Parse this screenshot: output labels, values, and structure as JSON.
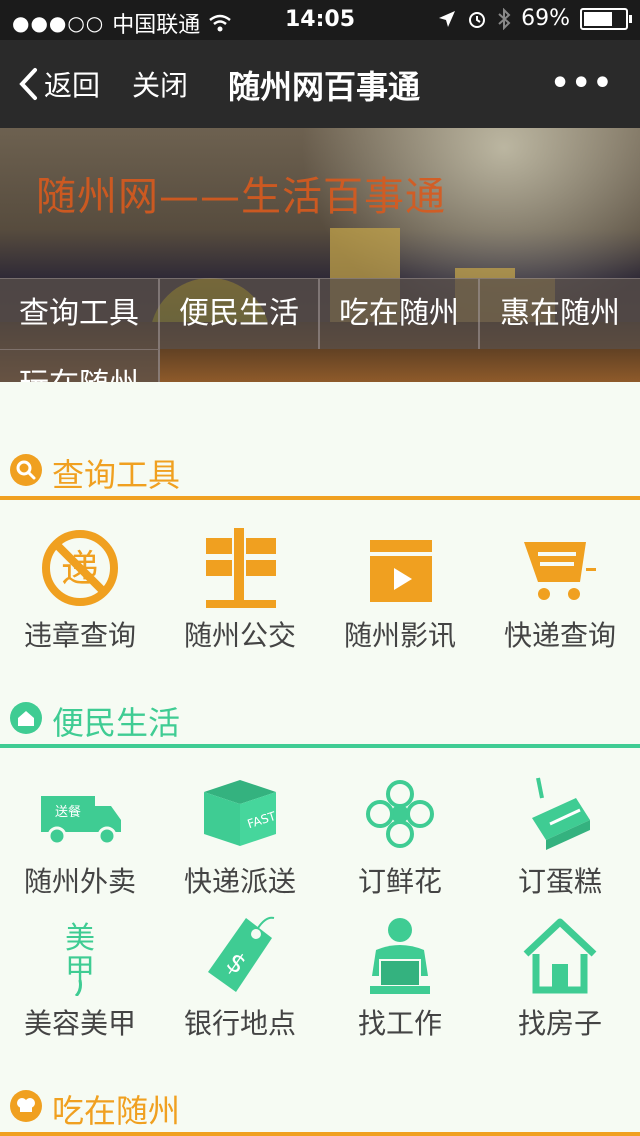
{
  "status": {
    "carrier": "中国联通",
    "signal_dots": "●●●○○",
    "time": "14:05",
    "battery": "69%"
  },
  "nav": {
    "back_label": "返回",
    "close_label": "关闭",
    "title": "随州网百事通",
    "more_label": "•••"
  },
  "banner": {
    "headline": "随州网——生活百事通",
    "tabs": [
      "查询工具",
      "便民生活",
      "吃在随州",
      "惠在随州",
      "玩在随州"
    ]
  },
  "colors": {
    "orange": "#f0a020",
    "green": "#3fcc93"
  },
  "sections": [
    {
      "title": "查询工具",
      "icon": "search-icon",
      "color": "#f0a020",
      "items": [
        {
          "label": "违章查询",
          "icon": "no-delivery-icon"
        },
        {
          "label": "随州公交",
          "icon": "bus-sign-icon"
        },
        {
          "label": "随州影讯",
          "icon": "movie-clapper-icon"
        },
        {
          "label": "快递查询",
          "icon": "cart-icon"
        }
      ]
    },
    {
      "title": "便民生活",
      "icon": "home-icon",
      "color": "#3fcc93",
      "items": [
        {
          "label": "随州外卖",
          "icon": "delivery-truck-icon"
        },
        {
          "label": "快递派送",
          "icon": "package-box-icon"
        },
        {
          "label": "订鲜花",
          "icon": "flower-icon"
        },
        {
          "label": "订蛋糕",
          "icon": "cake-icon"
        },
        {
          "label": "美容美甲",
          "icon": "beauty-icon"
        },
        {
          "label": "银行地点",
          "icon": "price-tag-icon"
        },
        {
          "label": "找工作",
          "icon": "worker-icon"
        },
        {
          "label": "找房子",
          "icon": "house-icon"
        }
      ]
    },
    {
      "title": "吃在随州",
      "icon": "chef-hat-icon",
      "color": "#f0a020",
      "items": []
    }
  ]
}
